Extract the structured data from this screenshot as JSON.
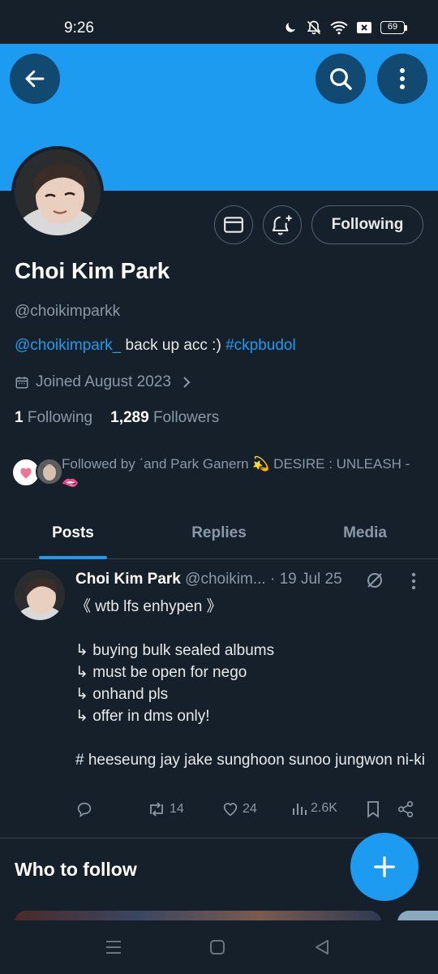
{
  "status_bar": {
    "time": "9:26",
    "battery": "69",
    "icons": [
      "moon-icon",
      "bell-off-icon",
      "wifi-icon",
      "sim-x-icon",
      "battery-icon"
    ]
  },
  "header": {
    "banner_color": "#1d9bf0",
    "back_icon": "arrow-left-icon",
    "search_icon": "search-icon",
    "more_icon": "more-vertical-icon"
  },
  "profile": {
    "display_name": "Choi Kim Park",
    "handle": "@choikimparkk",
    "bio_link": "@choikimpark_",
    "bio_text": " back up acc :) ",
    "bio_hashtag": "#ckpbudol",
    "joined": "Joined August 2023",
    "following_count": "1",
    "following_label": "Following",
    "followers_count": "1,289",
    "followers_label": "Followers",
    "follow_button": "Following",
    "followed_by": "Followed by ˊand Park Ganern 💫 DESIRE : UNLEASH - 🫦"
  },
  "tabs": [
    {
      "label": "Posts",
      "active": true
    },
    {
      "label": "Replies",
      "active": false
    },
    {
      "label": "Media",
      "active": false
    }
  ],
  "post": {
    "name": "Choi Kim Park",
    "handle_date": " @choikim... · 19 Jul 25",
    "lines": [
      "《 wtb lfs enhypen 》",
      "",
      "↳ buying bulk sealed albums",
      "↳ must be open for nego",
      "↳ onhand pls",
      "↳ offer in dms only!",
      "",
      "# heeseung jay jake sunghoon sunoo jungwon ni-ki"
    ],
    "retweets": "14",
    "likes": "24",
    "views": "2.6K"
  },
  "who_to_follow": {
    "title": "Who to follow"
  },
  "colors": {
    "background": "#15202b",
    "accent": "#1d9bf0",
    "muted": "#8b98a5",
    "border": "#38444d"
  }
}
